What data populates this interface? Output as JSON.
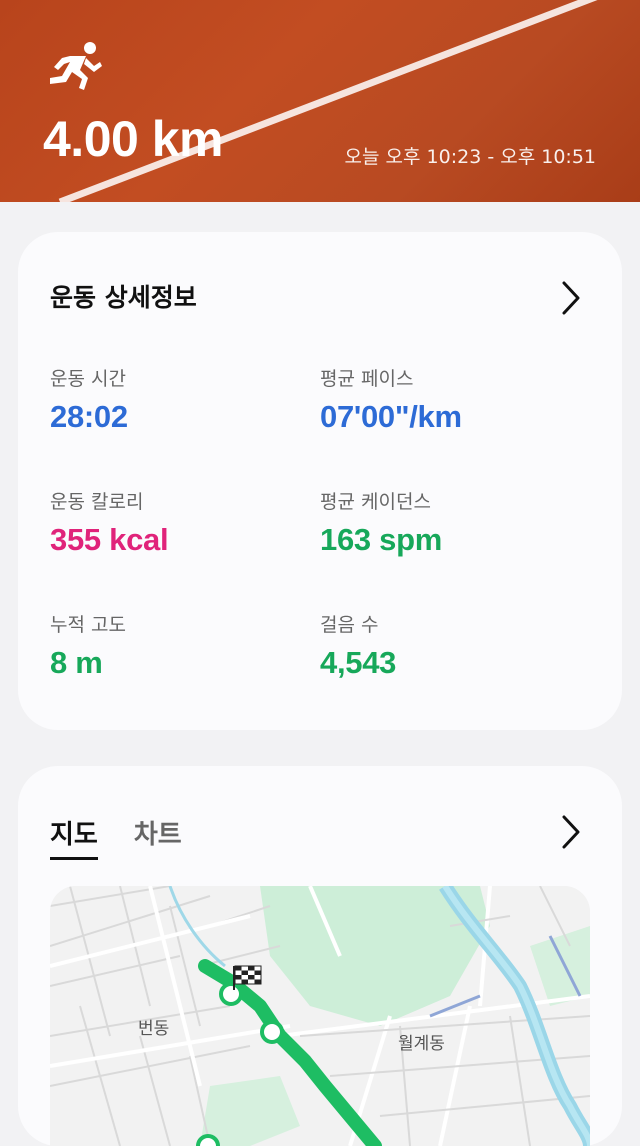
{
  "header": {
    "distance": "4.00 km",
    "time_range": "오늘 오후 10:23 - 오후 10:51",
    "icon": "running-icon"
  },
  "details": {
    "title": "운동 상세정보",
    "stats": [
      {
        "label": "운동 시간",
        "value": "28:02",
        "color": "#2d6bd6"
      },
      {
        "label": "평균 페이스",
        "value": "07'00\"/km",
        "color": "#2d6bd6"
      },
      {
        "label": "운동 칼로리",
        "value": "355 kcal",
        "color": "#e0237a"
      },
      {
        "label": "평균 케이던스",
        "value": "163 spm",
        "color": "#17a85a"
      },
      {
        "label": "누적 고도",
        "value": "8 m",
        "color": "#17a85a"
      },
      {
        "label": "걸음 수",
        "value": "4,543",
        "color": "#17a85a"
      }
    ]
  },
  "map_section": {
    "tabs": [
      "지도",
      "차트"
    ],
    "active_tab": "지도",
    "map_labels": [
      "번동",
      "월계동"
    ]
  },
  "colors": {
    "route": "#1ebd63",
    "hero": "#c24d22",
    "river": "#8fd3e6",
    "park": "#c7ecd2"
  }
}
